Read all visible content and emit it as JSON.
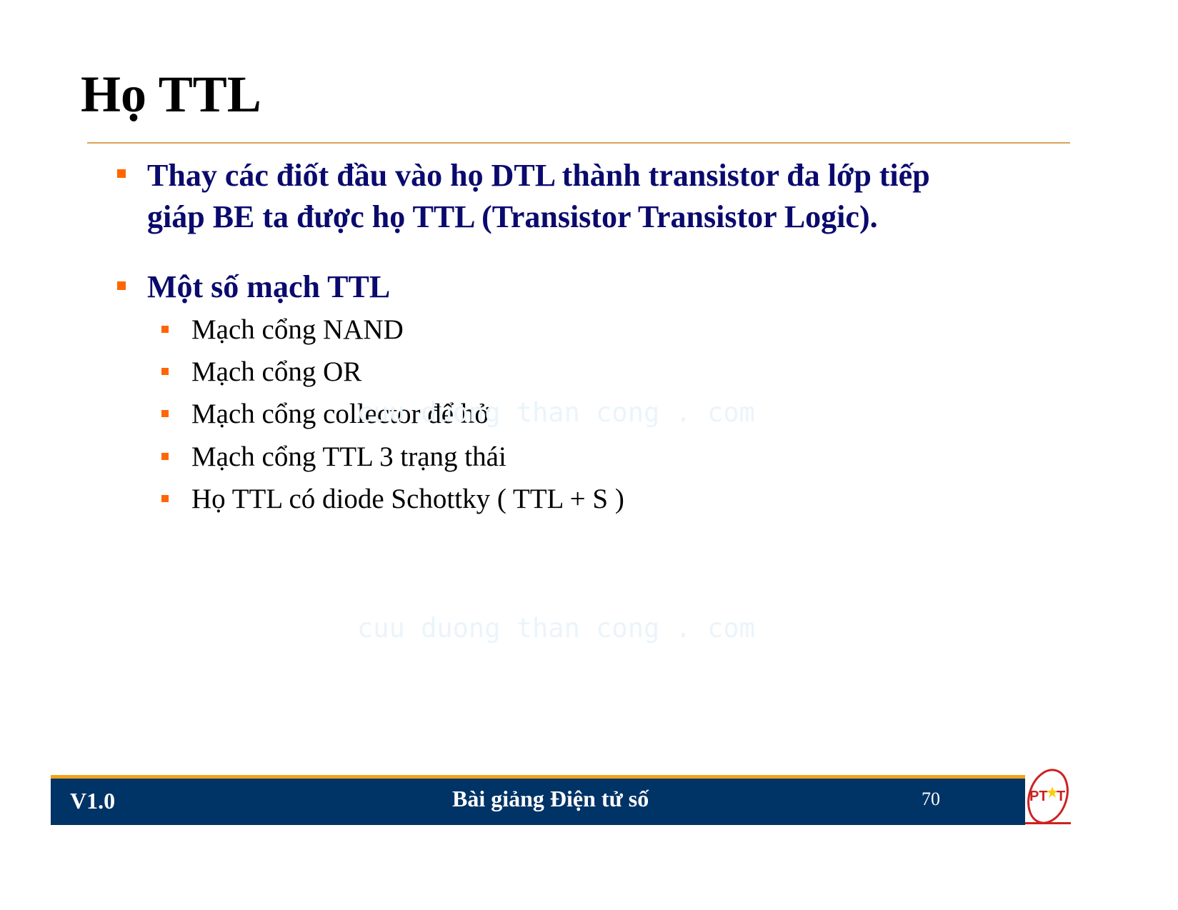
{
  "slide": {
    "title": "Họ TTL",
    "bullets": [
      {
        "lines": [
          "Thay các điốt đầu vào họ DTL thành transistor đa lớp tiếp",
          "giáp BE ta được họ TTL (Transistor Transistor Logic)."
        ]
      },
      {
        "text": "Một số mạch TTL",
        "subitems": [
          "Mạch cổng NAND",
          "Mạch cổng OR",
          "Mạch cổng collector để hở",
          "Mạch cổng TTL 3 trạng thái",
          "Họ TTL có diode Schottky ( TTL + S )"
        ]
      }
    ],
    "watermark": "cuu duong than cong . com"
  },
  "footer": {
    "version": "V1.0",
    "course_title": "Bài giảng Điện tử số",
    "page_number": "70",
    "logo_text": "PTIT",
    "logo_icon": "ptit-logo-icon"
  },
  "colors": {
    "heading_text": "#000000",
    "body_bold_text": "#0a0a6e",
    "bullet": "#ff6600",
    "title_rule": "#d9a35a",
    "footer_bar": "#003366",
    "footer_accent": "#f5a21b",
    "logo_red": "#cc2222",
    "logo_star": "#ffcc00"
  }
}
